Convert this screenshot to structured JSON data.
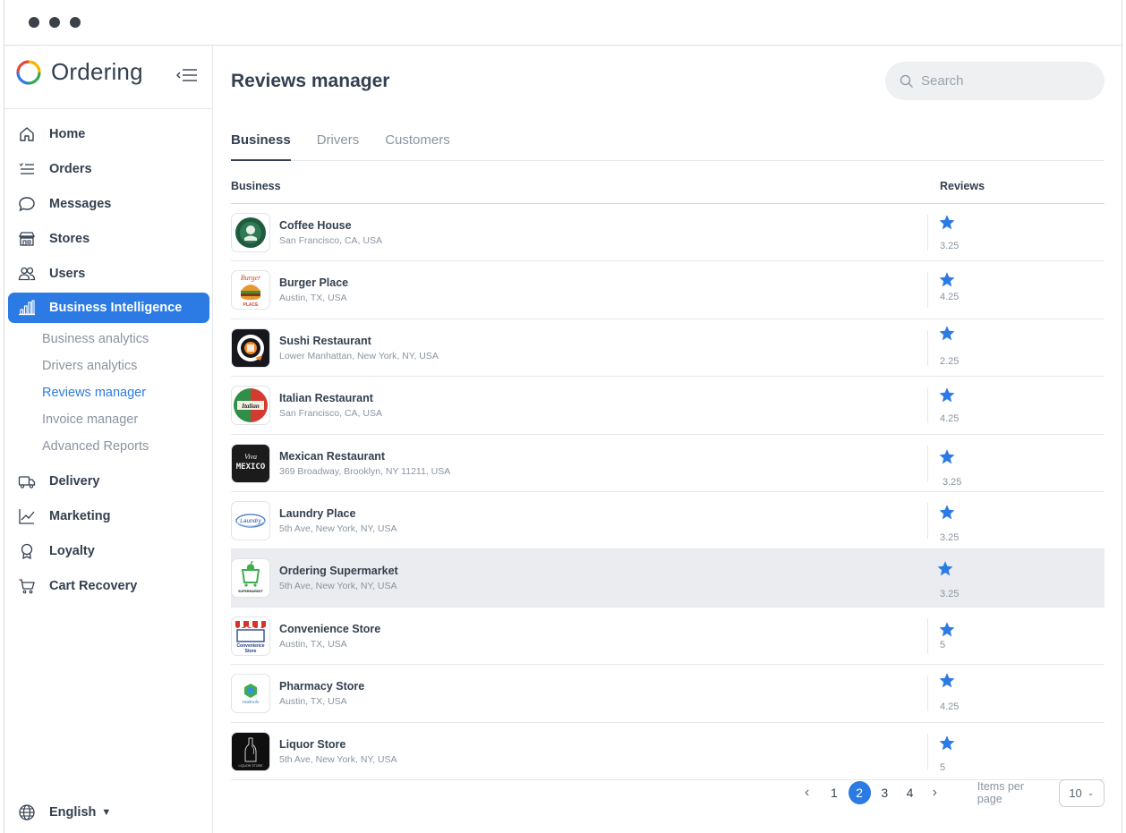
{
  "window": {
    "controls": [
      "close",
      "minimize",
      "maximize"
    ]
  },
  "brand": {
    "name": "Ordering",
    "logo_icon": "ordering-ring-logo",
    "colors": [
      "#e24a3b",
      "#f5b400",
      "#34a853",
      "#2c7be5"
    ]
  },
  "sidebar": {
    "items": [
      {
        "label": "Home",
        "icon": "home-icon"
      },
      {
        "label": "Orders",
        "icon": "list-icon"
      },
      {
        "label": "Messages",
        "icon": "chat-bubble-icon"
      },
      {
        "label": "Stores",
        "icon": "store-icon"
      },
      {
        "label": "Users",
        "icon": "users-icon"
      },
      {
        "label": "Business Intelligence",
        "icon": "bar-chart-icon",
        "active": true
      }
    ],
    "subitems": [
      {
        "label": "Business analytics"
      },
      {
        "label": "Drivers analytics"
      },
      {
        "label": "Reviews manager",
        "current": true
      },
      {
        "label": "Invoice manager"
      },
      {
        "label": "Advanced Reports"
      }
    ],
    "items_after": [
      {
        "label": "Delivery",
        "icon": "truck-icon"
      },
      {
        "label": "Marketing",
        "icon": "trend-icon"
      },
      {
        "label": "Loyalty",
        "icon": "award-icon"
      },
      {
        "label": "Cart Recovery",
        "icon": "cart-icon"
      }
    ],
    "language": {
      "label": "English",
      "icon": "globe-icon"
    }
  },
  "header": {
    "title": "Reviews manager",
    "search_placeholder": "Search"
  },
  "tabs": [
    {
      "label": "Business",
      "active": true
    },
    {
      "label": "Drivers"
    },
    {
      "label": "Customers"
    }
  ],
  "table": {
    "columns": [
      "Business",
      "Reviews"
    ],
    "rows": [
      {
        "name": "Coffee House",
        "address": "San Francisco, CA, USA",
        "score": "3.25",
        "logo": "coffee-logo"
      },
      {
        "name": "Burger Place",
        "address": "Austin, TX, USA",
        "score": "4.25",
        "logo": "burger-logo"
      },
      {
        "name": "Sushi Restaurant",
        "address": "Lower Manhattan, New York, NY, USA",
        "score": "2.25",
        "logo": "sushi-logo"
      },
      {
        "name": "Italian Restaurant",
        "address": "San Francisco, CA, USA",
        "score": "4.25",
        "logo": "italian-logo"
      },
      {
        "name": "Mexican Restaurant",
        "address": "369 Broadway, Brooklyn, NY 11211, USA",
        "score": "3.25",
        "logo": "mexico-logo"
      },
      {
        "name": "Laundry Place",
        "address": "5th Ave, New York, NY, USA",
        "score": "3.25",
        "logo": "laundry-logo"
      },
      {
        "name": "Ordering Supermarket",
        "address": "5th Ave, New York, NY, USA",
        "score": "3.25",
        "logo": "supermarket-logo",
        "highlight": true
      },
      {
        "name": "Convenience Store",
        "address": "Austin, TX, USA",
        "score": "5",
        "logo": "convenience-logo"
      },
      {
        "name": "Pharmacy Store",
        "address": "Austin, TX, USA",
        "score": "4.25",
        "logo": "pharmacy-logo"
      },
      {
        "name": "Liquor Store",
        "address": "5th Ave, New York, NY, USA",
        "score": "5",
        "logo": "liquor-logo"
      }
    ],
    "star_color": "#2c7be5"
  },
  "pagination": {
    "pages": [
      "1",
      "2",
      "3",
      "4"
    ],
    "current": "2",
    "items_per_page_label": "Items per page",
    "items_per_page_value": "10"
  },
  "logo_texts": {
    "burger": "Burger",
    "burger_sub": "PLACE",
    "italian": "Italian",
    "mexico_top": "Viva",
    "mexico": "MEXICO",
    "laundry": "Laundry",
    "supermarket": "SUPERMARKET",
    "convenience": "Convenience",
    "convenience_sub": "Store",
    "pharmacy": "HealthLife",
    "liquor": "LIQUOR STORE"
  }
}
